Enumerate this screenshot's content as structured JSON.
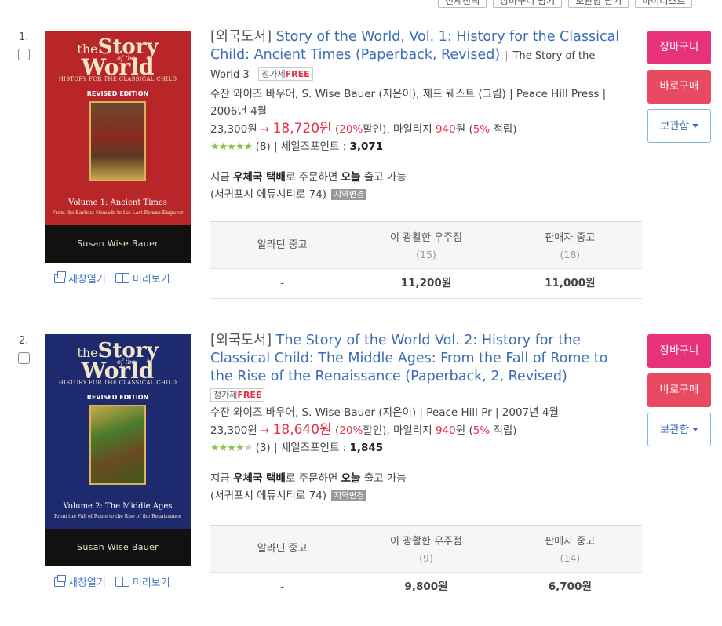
{
  "topbar": {
    "buttons": [
      "전체선택",
      "장바구니 담기",
      "보관함 담기",
      "바이러스트"
    ]
  },
  "items": [
    {
      "num": "1.",
      "cover": {
        "the": "the",
        "story": "Story",
        "of": "of the",
        "world": "World",
        "history": "HISTORY FOR THE CLASSICAL CHILD",
        "edition": "REVISED EDITION",
        "volume": "Volume 1: Ancient Times",
        "subtitle": "From the Earliest Nomads to the Last Roman Emperor",
        "author": "Susan Wise Bauer",
        "bg": "#b8262a",
        "art_bg": "#5a3a2a"
      },
      "links": {
        "new_window": "새창열기",
        "preview": "미리보기"
      },
      "category": "[외국도서]",
      "title": "Story of the World, Vol. 1: History for the Classical Child: Ancient Times (Paperback, Revised)",
      "series": "The Story of the World 3",
      "badge_label": "정가제",
      "badge_free": "FREE",
      "authors": "수잔 와이즈 바우어, S. Wise Bauer (지은이), 제프 웨스트 (그림) | Peace Hill Press | 2006년 4월",
      "list_price": "23,300원",
      "arrow": "→",
      "sale_price": "18,720원",
      "discount": "20%",
      "discount_suffix": "할인), 마일리지",
      "mileage": "940",
      "mileage_unit": "원 (",
      "mileage_rate": "5%",
      "mileage_suffix": "적립)",
      "rating_count": "(8)",
      "sales_point_label": "| 세일즈포인트 :",
      "sales_point": "3,071",
      "rating_stars": 5,
      "delivery_pre": "지금",
      "delivery_method": "우체국 택배",
      "delivery_mid": "로 주문하면",
      "delivery_day": "오늘",
      "delivery_post": "출고 가능",
      "address": "(서귀포시 에듀시티로 74)",
      "region_tag": "지역변경",
      "used": {
        "col1": "알라딘 중고",
        "col2": "이 광활한 우주점",
        "col2_count": "(15)",
        "col3": "판매자 중고",
        "col3_count": "(18)",
        "val1": "-",
        "val2": "11,200원",
        "val3": "11,000원"
      },
      "buttons": {
        "cart": "장바구니",
        "buy": "바로구매",
        "keep": "보관함"
      }
    },
    {
      "num": "2.",
      "cover": {
        "the": "the",
        "story": "Story",
        "of": "of the",
        "world": "World",
        "history": "HISTORY FOR THE CLASSICAL CHILD",
        "edition": "REVISED EDITION",
        "volume": "Volume 2: The Middle Ages",
        "subtitle": "From the Fall of Rome to the Rise of the Renaissance",
        "author": "Susan Wise Bauer",
        "bg": "#1e2a6e",
        "art_bg": "#4a6a2a"
      },
      "links": {
        "new_window": "새창열기",
        "preview": "미리보기"
      },
      "category": "[외국도서]",
      "title": "The Story of the World Vol. 2: History for the Classical Child: The Middle Ages: From the Fall of Rome to the Rise of the Renaissance (Paperback, 2, Revised)",
      "series": "",
      "badge_label": "정가제",
      "badge_free": "FREE",
      "authors": "수잔 와이즈 바우어, S. Wise Bauer (지은이) | Peace Hill Pr | 2007년 4월",
      "list_price": "23,300원",
      "arrow": "→",
      "sale_price": "18,640원",
      "discount": "20%",
      "discount_suffix": "할인), 마일리지",
      "mileage": "940",
      "mileage_unit": "원 (",
      "mileage_rate": "5%",
      "mileage_suffix": "적립)",
      "rating_count": "(3)",
      "sales_point_label": "| 세일즈포인트 :",
      "sales_point": "1,845",
      "rating_stars": 4,
      "delivery_pre": "지금",
      "delivery_method": "우체국 택배",
      "delivery_mid": "로 주문하면",
      "delivery_day": "오늘",
      "delivery_post": "출고 가능",
      "address": "(서귀포시 에듀시티로 74)",
      "region_tag": "지역변경",
      "used": {
        "col1": "알라딘 중고",
        "col2": "이 광활한 우주점",
        "col2_count": "(9)",
        "col3": "판매자 중고",
        "col3_count": "(14)",
        "val1": "-",
        "val2": "9,800원",
        "val3": "6,700원"
      },
      "buttons": {
        "cart": "장바구니",
        "buy": "바로구매",
        "keep": "보관함"
      }
    }
  ],
  "colors": {
    "link": "#3b6db5",
    "price_red": "#e8314a",
    "cart_pink": "#e8317b",
    "buy_red": "#e84a5f",
    "star_green": "#8bc34a"
  }
}
